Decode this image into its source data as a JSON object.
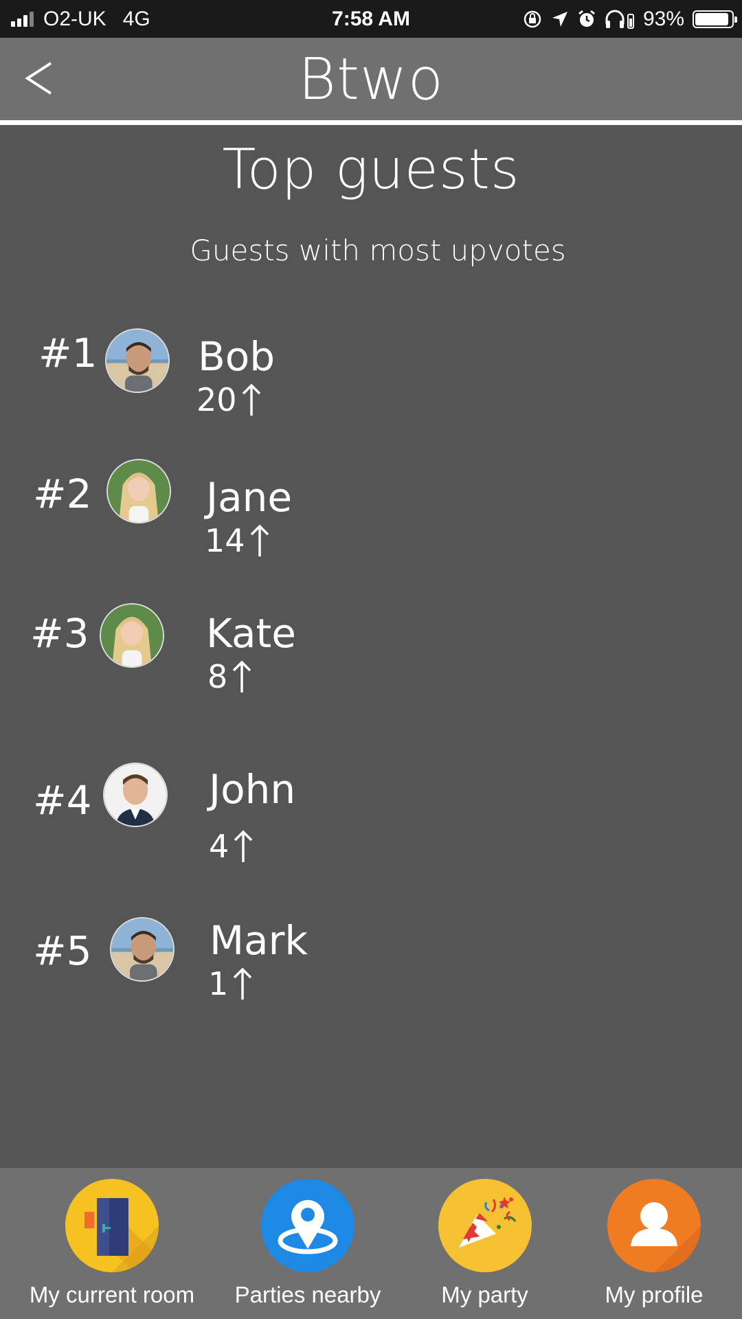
{
  "status_bar": {
    "carrier": "O2-UK",
    "network": "4G",
    "time": "7:58 AM",
    "battery": "93%",
    "battery_level": 0.93
  },
  "header": {
    "title": "Btwo",
    "back_icon": "chevron-left-icon"
  },
  "main": {
    "title": "Top guests",
    "subtitle": "Guests with most upvotes"
  },
  "guests": [
    {
      "rank": "#1",
      "name": "Bob",
      "votes": "20",
      "avatar": "male-beach"
    },
    {
      "rank": "#2",
      "name": "Jane",
      "votes": "14",
      "avatar": "female-blonde"
    },
    {
      "rank": "#3",
      "name": "Kate",
      "votes": "8",
      "avatar": "female-blonde"
    },
    {
      "rank": "#4",
      "name": "John",
      "votes": "4",
      "avatar": "male-suit"
    },
    {
      "rank": "#5",
      "name": "Mark",
      "votes": "1",
      "avatar": "male-beach"
    }
  ],
  "nav": [
    {
      "label": "My current room",
      "icon": "door-icon",
      "color": "#f6c221"
    },
    {
      "label": "Parties nearby",
      "icon": "location-pin-icon",
      "color": "#1e88e5"
    },
    {
      "label": "My party",
      "icon": "party-popper-icon",
      "color": "#f6c233"
    },
    {
      "label": "My profile",
      "icon": "user-icon",
      "color": "#ef7b22"
    }
  ]
}
